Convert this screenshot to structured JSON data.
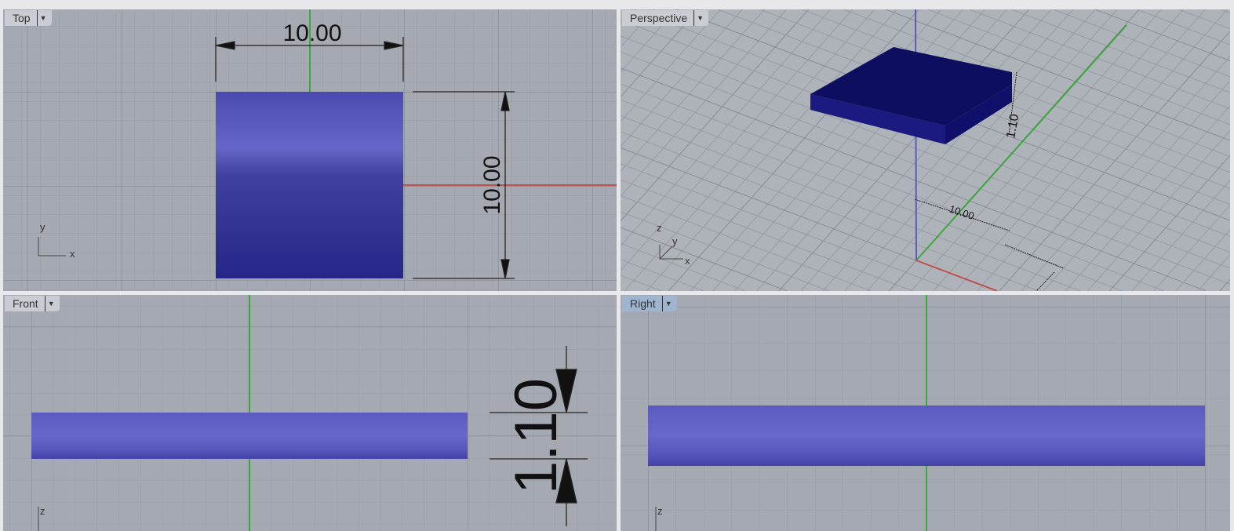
{
  "viewports": {
    "top": {
      "label": "Top",
      "dim_width": "10.00",
      "dim_height": "10.00",
      "axis_x": "x",
      "axis_y": "y"
    },
    "perspective": {
      "label": "Perspective",
      "dim_thickness": "1.10",
      "dim_width": "10.00",
      "axis_x": "x",
      "axis_y": "y",
      "axis_z": "z"
    },
    "front": {
      "label": "Front",
      "dim_thickness": "1.10",
      "axis_z": "z"
    },
    "right": {
      "label": "Right",
      "axis_z": "z"
    }
  },
  "colors": {
    "x_axis": "#c0504d",
    "y_axis": "#3da53d",
    "z_axis": "#5b5bb5",
    "object": "#5a5ac0",
    "grid_bg": "#a5aab2"
  }
}
